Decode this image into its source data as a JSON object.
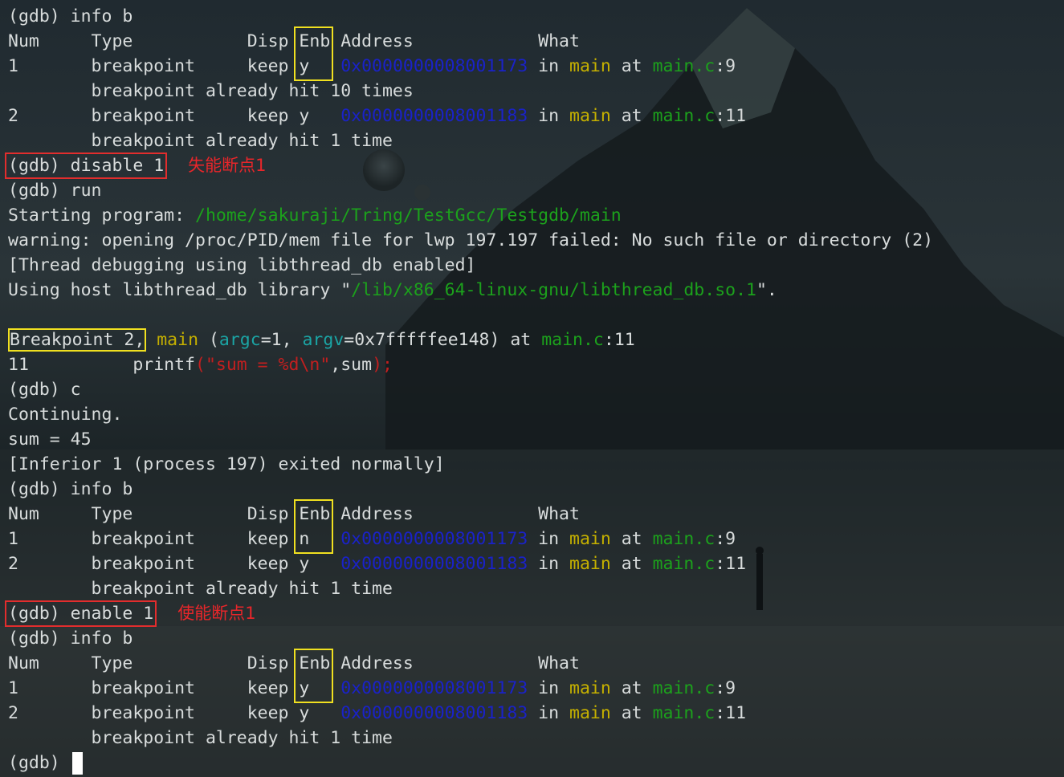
{
  "lines": [
    {
      "segs": [
        {
          "t": "(gdb) info b"
        }
      ]
    },
    {
      "segs": [
        {
          "t": "Num     Type           Disp Enb Address            What"
        }
      ]
    },
    {
      "segs": [
        {
          "t": "1       breakpoint     keep y   "
        },
        {
          "t": "0x0000000008001173",
          "c": "b"
        },
        {
          "t": " in "
        },
        {
          "t": "main",
          "c": "y"
        },
        {
          "t": " at "
        },
        {
          "t": "main.c",
          "c": "g"
        },
        {
          "t": ":9"
        }
      ]
    },
    {
      "segs": [
        {
          "t": "        breakpoint already hit 10 times"
        }
      ]
    },
    {
      "segs": [
        {
          "t": "2       breakpoint     keep y   "
        },
        {
          "t": "0x0000000008001183",
          "c": "b"
        },
        {
          "t": " in "
        },
        {
          "t": "main",
          "c": "y"
        },
        {
          "t": " at "
        },
        {
          "t": "main.c",
          "c": "g"
        },
        {
          "t": ":11"
        }
      ]
    },
    {
      "segs": [
        {
          "t": "        breakpoint already hit 1 time"
        }
      ]
    },
    {
      "segs": [
        {
          "t": "(gdb) disable 1",
          "box": "red"
        },
        {
          "t": "失能断点1",
          "ann": true
        }
      ]
    },
    {
      "segs": [
        {
          "t": "(gdb) run"
        }
      ]
    },
    {
      "segs": [
        {
          "t": "Starting program: "
        },
        {
          "t": "/home/sakuraji/Tring/TestGcc/Testgdb/main",
          "c": "g"
        }
      ]
    },
    {
      "segs": [
        {
          "t": "warning: opening /proc/PID/mem file for lwp 197.197 failed: No such file or directory (2)"
        }
      ]
    },
    {
      "segs": [
        {
          "t": "[Thread debugging using libthread_db enabled]"
        }
      ]
    },
    {
      "segs": [
        {
          "t": "Using host libthread_db library \""
        },
        {
          "t": "/lib/x86_64-linux-gnu/libthread_db.so.1",
          "c": "g"
        },
        {
          "t": "\"."
        }
      ]
    },
    {
      "segs": [
        {
          "t": ""
        }
      ]
    },
    {
      "segs": [
        {
          "t": "Breakpoint 2,",
          "box": "yellow"
        },
        {
          "t": " "
        },
        {
          "t": "main",
          "c": "y"
        },
        {
          "t": " ("
        },
        {
          "t": "argc",
          "c": "c"
        },
        {
          "t": "=1, "
        },
        {
          "t": "argv",
          "c": "c"
        },
        {
          "t": "=0x7fffffee148) at "
        },
        {
          "t": "main.c",
          "c": "g"
        },
        {
          "t": ":11"
        }
      ]
    },
    {
      "segs": [
        {
          "t": "11          printf"
        },
        {
          "t": "(\"sum = %d\\n\"",
          "c": "r"
        },
        {
          "t": ",sum"
        },
        {
          "t": ");",
          "c": "r"
        }
      ]
    },
    {
      "segs": [
        {
          "t": "(gdb) c"
        }
      ]
    },
    {
      "segs": [
        {
          "t": "Continuing."
        }
      ]
    },
    {
      "segs": [
        {
          "t": "sum = 45"
        }
      ]
    },
    {
      "segs": [
        {
          "t": "[Inferior 1 (process 197) exited normally]"
        }
      ]
    },
    {
      "segs": [
        {
          "t": "(gdb) info b"
        }
      ]
    },
    {
      "segs": [
        {
          "t": "Num     Type           Disp Enb Address            What"
        }
      ]
    },
    {
      "segs": [
        {
          "t": "1       breakpoint     keep n   "
        },
        {
          "t": "0x0000000008001173",
          "c": "b"
        },
        {
          "t": " in "
        },
        {
          "t": "main",
          "c": "y"
        },
        {
          "t": " at "
        },
        {
          "t": "main.c",
          "c": "g"
        },
        {
          "t": ":9"
        }
      ]
    },
    {
      "segs": [
        {
          "t": "2       breakpoint     keep y   "
        },
        {
          "t": "0x0000000008001183",
          "c": "b"
        },
        {
          "t": " in "
        },
        {
          "t": "main",
          "c": "y"
        },
        {
          "t": " at "
        },
        {
          "t": "main.c",
          "c": "g"
        },
        {
          "t": ":11"
        }
      ]
    },
    {
      "segs": [
        {
          "t": "        breakpoint already hit 1 time"
        }
      ]
    },
    {
      "segs": [
        {
          "t": "(gdb) enable 1",
          "box": "red"
        },
        {
          "t": "使能断点1",
          "ann": true
        }
      ]
    },
    {
      "segs": [
        {
          "t": "(gdb) info b"
        }
      ]
    },
    {
      "segs": [
        {
          "t": "Num     Type           Disp Enb Address            What"
        }
      ]
    },
    {
      "segs": [
        {
          "t": "1       breakpoint     keep y   "
        },
        {
          "t": "0x0000000008001173",
          "c": "b"
        },
        {
          "t": " in "
        },
        {
          "t": "main",
          "c": "y"
        },
        {
          "t": " at "
        },
        {
          "t": "main.c",
          "c": "g"
        },
        {
          "t": ":9"
        }
      ]
    },
    {
      "segs": [
        {
          "t": "2       breakpoint     keep y   "
        },
        {
          "t": "0x0000000008001183",
          "c": "b"
        },
        {
          "t": " in "
        },
        {
          "t": "main",
          "c": "y"
        },
        {
          "t": " at "
        },
        {
          "t": "main.c",
          "c": "g"
        },
        {
          "t": ":11"
        }
      ]
    },
    {
      "segs": [
        {
          "t": "        breakpoint already hit 1 time"
        }
      ]
    },
    {
      "segs": [
        {
          "t": "(gdb) "
        }
      ],
      "cursor": true
    }
  ]
}
